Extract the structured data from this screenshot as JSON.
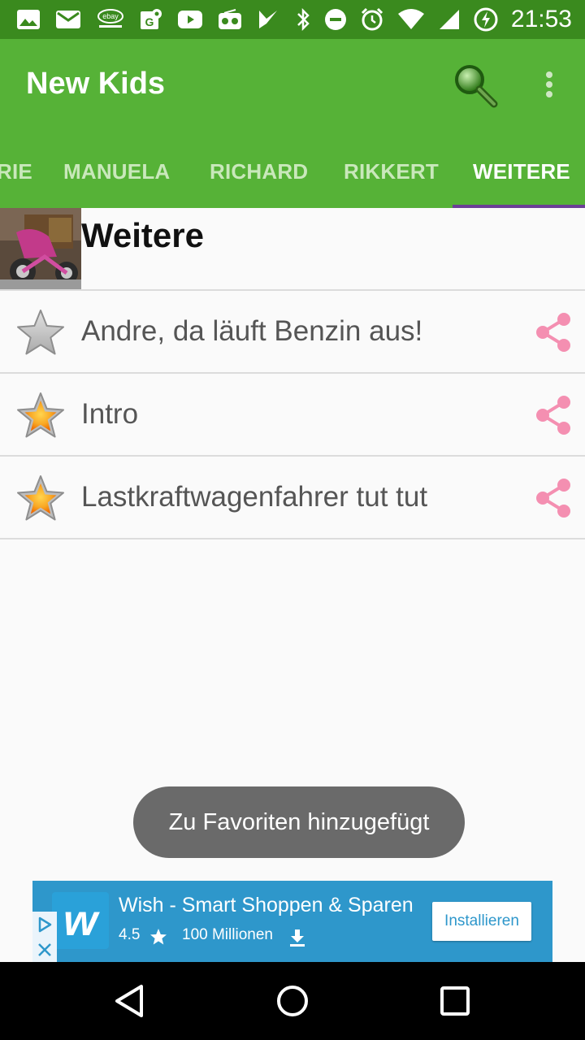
{
  "status_bar": {
    "time": "21:53",
    "left_icons": [
      "image-icon",
      "mail-icon",
      "ebay-kleinanzeigen-icon",
      "maps-icon",
      "youtube-icon",
      "radio-icon",
      "checkmark-flag-icon"
    ],
    "right_icons": [
      "bluetooth-icon",
      "do-not-disturb-icon",
      "alarm-icon",
      "wifi-icon",
      "signal-icon",
      "battery-charging-icon"
    ]
  },
  "app_bar": {
    "title": "New Kids",
    "search_icon": "search-icon",
    "menu_icon": "more-vert-icon"
  },
  "tabs": {
    "items": [
      {
        "label": "RIE",
        "active": false
      },
      {
        "label": "MANUELA",
        "active": false
      },
      {
        "label": "RICHARD",
        "active": false
      },
      {
        "label": "RIKKERT",
        "active": false
      },
      {
        "label": "WEITERE",
        "active": true
      }
    ],
    "indicator_color": "#6b3f96"
  },
  "category": {
    "title": "Weitere"
  },
  "list": {
    "items": [
      {
        "label": "Andre, da läuft Benzin aus!",
        "favorite": false
      },
      {
        "label": "Intro",
        "favorite": true
      },
      {
        "label": "Lastkraftwagenfahrer tut tut",
        "favorite": true
      }
    ]
  },
  "toast": {
    "text": "Zu Favoriten hinzugefügt"
  },
  "ad": {
    "title": "Wish - Smart Shoppen & Sparen",
    "rating": "4.5",
    "downloads": "100 Millionen",
    "install_label": "Installieren",
    "logo_letter": "w",
    "background": "#2e97cb"
  },
  "colors": {
    "app_bar": "#56b237",
    "status_bar": "#3a8a1e",
    "share": "#f48fb1",
    "star_active": "#f9a825"
  }
}
